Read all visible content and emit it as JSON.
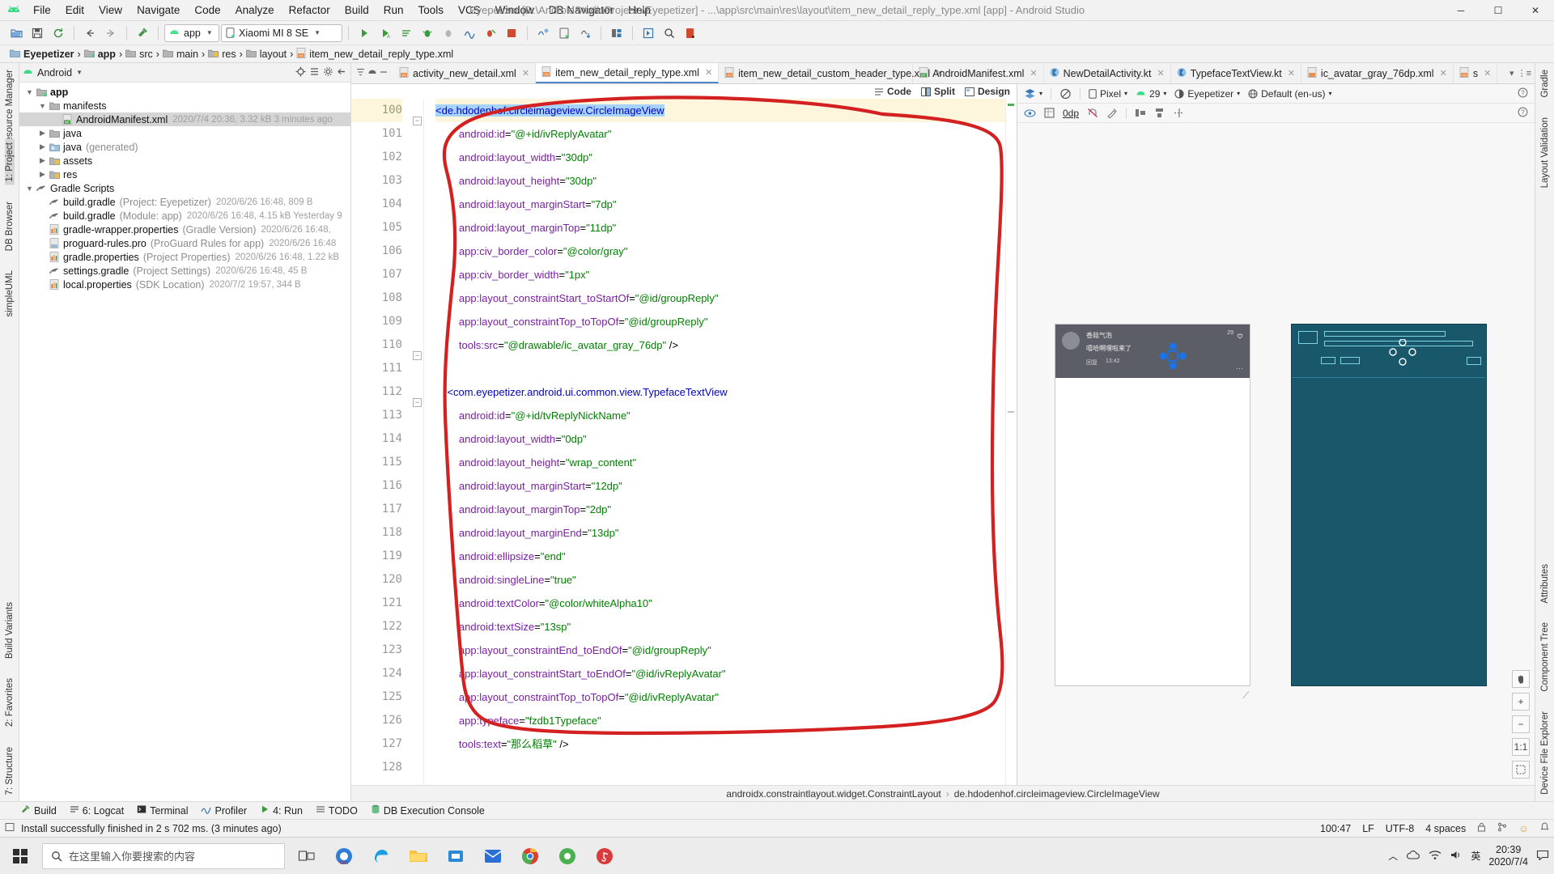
{
  "titlebar": {
    "menus": [
      "File",
      "Edit",
      "View",
      "Navigate",
      "Code",
      "Analyze",
      "Refactor",
      "Build",
      "Run",
      "Tools",
      "VCS",
      "Window",
      "DB Navigator",
      "Help"
    ],
    "window_title": "Eyepetizer [D:\\AndroidStudioProjects\\Eyepetizer] - ...\\app\\src\\main\\res\\layout\\item_new_detail_reply_type.xml [app] - Android Studio",
    "minimize": "─",
    "maximize": "☐",
    "close": "✕"
  },
  "toolbar": {
    "module_selector": "app",
    "device_selector": "Xiaomi MI 8 SE"
  },
  "breadcrumb": {
    "items": [
      {
        "label": "Eyepetizer",
        "bold": true,
        "icon": "project-icon"
      },
      {
        "label": "app",
        "bold": true,
        "icon": "module-icon"
      },
      {
        "label": "src",
        "bold": false,
        "icon": "folder-icon"
      },
      {
        "label": "main",
        "bold": false,
        "icon": "folder-icon"
      },
      {
        "label": "res",
        "bold": false,
        "icon": "res-folder-icon"
      },
      {
        "label": "layout",
        "bold": false,
        "icon": "folder-icon"
      },
      {
        "label": "item_new_detail_reply_type.xml",
        "bold": false,
        "icon": "xml-file-icon"
      }
    ]
  },
  "left_rail": {
    "top": [
      "Resource Manager"
    ],
    "middle": [
      "1: Project",
      "DB Browser",
      "simpleUML"
    ],
    "bottom": [
      "Build Variants",
      "2: Favorites",
      "7: Structure"
    ]
  },
  "right_rail": {
    "items": [
      "Gradle",
      "Layout Validation",
      "Attributes",
      "Component Tree",
      "Device File Explorer"
    ]
  },
  "project_panel": {
    "title": "Android",
    "tree": [
      {
        "indent": 0,
        "arrow": "open",
        "icon": "module-icon",
        "label": "app",
        "bold": true,
        "meta": "",
        "sub": ""
      },
      {
        "indent": 1,
        "arrow": "open",
        "icon": "folder-icon",
        "label": "manifests",
        "bold": false,
        "meta": "",
        "sub": ""
      },
      {
        "indent": 2,
        "arrow": "none",
        "icon": "manifest-icon",
        "label": "AndroidManifest.xml",
        "bold": false,
        "meta": "2020/7/4 20:36, 3.32 kB  3 minutes ago",
        "sub": "",
        "selected": true
      },
      {
        "indent": 1,
        "arrow": "closed",
        "icon": "folder-icon",
        "label": "java",
        "bold": false,
        "meta": "",
        "sub": ""
      },
      {
        "indent": 1,
        "arrow": "closed",
        "icon": "folder-gen-icon",
        "label": "java",
        "bold": false,
        "meta": "",
        "sub": "(generated)"
      },
      {
        "indent": 1,
        "arrow": "closed",
        "icon": "res-folder-icon",
        "label": "assets",
        "bold": false,
        "meta": "",
        "sub": ""
      },
      {
        "indent": 1,
        "arrow": "closed",
        "icon": "res-folder-icon",
        "label": "res",
        "bold": false,
        "meta": "",
        "sub": ""
      },
      {
        "indent": 0,
        "arrow": "open",
        "icon": "gradle-icon",
        "label": "Gradle Scripts",
        "bold": false,
        "meta": "",
        "sub": ""
      },
      {
        "indent": 1,
        "arrow": "none",
        "icon": "gradle-icon",
        "label": "build.gradle",
        "bold": false,
        "meta": "2020/6/26 16:48, 809 B",
        "sub": "(Project: Eyepetizer)"
      },
      {
        "indent": 1,
        "arrow": "none",
        "icon": "gradle-icon",
        "label": "build.gradle",
        "bold": false,
        "meta": "2020/6/26 16:48, 4.15 kB  Yesterday 9",
        "sub": "(Module: app)"
      },
      {
        "indent": 1,
        "arrow": "none",
        "icon": "properties-icon",
        "label": "gradle-wrapper.properties",
        "bold": false,
        "meta": "2020/6/26 16:48,",
        "sub": "(Gradle Version)"
      },
      {
        "indent": 1,
        "arrow": "none",
        "icon": "file-icon",
        "label": "proguard-rules.pro",
        "bold": false,
        "meta": "2020/6/26 16:48",
        "sub": "(ProGuard Rules for app)"
      },
      {
        "indent": 1,
        "arrow": "none",
        "icon": "properties-icon",
        "label": "gradle.properties",
        "bold": false,
        "meta": "2020/6/26 16:48, 1.22 kB",
        "sub": "(Project Properties)"
      },
      {
        "indent": 1,
        "arrow": "none",
        "icon": "gradle-icon",
        "label": "settings.gradle",
        "bold": false,
        "meta": "2020/6/26 16:48, 45 B",
        "sub": "(Project Settings)"
      },
      {
        "indent": 1,
        "arrow": "none",
        "icon": "properties-icon",
        "label": "local.properties",
        "bold": false,
        "meta": "2020/7/2 19:57, 344 B",
        "sub": "(SDK Location)"
      }
    ]
  },
  "editor_tabs": [
    {
      "label": "activity_new_detail.xml",
      "icon": "xml-file-icon",
      "active": false
    },
    {
      "label": "item_new_detail_reply_type.xml",
      "icon": "xml-file-icon",
      "active": true
    },
    {
      "label": "item_new_detail_custom_header_type.xml",
      "icon": "xml-file-icon",
      "active": false
    },
    {
      "label": "AndroidManifest.xml",
      "icon": "manifest-icon",
      "active": false
    },
    {
      "label": "NewDetailActivity.kt",
      "icon": "kotlin-file-icon",
      "active": false
    },
    {
      "label": "TypefaceTextView.kt",
      "icon": "kotlin-file-icon",
      "active": false
    },
    {
      "label": "ic_avatar_gray_76dp.xml",
      "icon": "drawable-file-icon",
      "active": false
    },
    {
      "label": "s",
      "icon": "xml-file-icon",
      "active": false
    }
  ],
  "editor_modes": {
    "code": "Code",
    "split": "Split",
    "design": "Design",
    "selected": "Split"
  },
  "code": {
    "first_line_number": 100,
    "lines": [
      {
        "n": 100,
        "indent": 0,
        "highlight": true,
        "tokens": [
          {
            "t": "<de.hdodenhof.circleimageview.CircleImageView",
            "c": "tag",
            "sel": true
          }
        ]
      },
      {
        "n": 101,
        "indent": 2,
        "tokens": [
          {
            "t": "android:id",
            "c": "attr"
          },
          {
            "t": "=",
            "c": "punc"
          },
          {
            "t": "\"@+id/ivReplyAvatar\"",
            "c": "val"
          }
        ]
      },
      {
        "n": 102,
        "indent": 2,
        "tokens": [
          {
            "t": "android:layout_width",
            "c": "attr"
          },
          {
            "t": "=",
            "c": "punc"
          },
          {
            "t": "\"30dp\"",
            "c": "val"
          }
        ]
      },
      {
        "n": 103,
        "indent": 2,
        "tokens": [
          {
            "t": "android:layout_height",
            "c": "attr"
          },
          {
            "t": "=",
            "c": "punc"
          },
          {
            "t": "\"30dp\"",
            "c": "val"
          }
        ]
      },
      {
        "n": 104,
        "indent": 2,
        "tokens": [
          {
            "t": "android:layout_marginStart",
            "c": "attr"
          },
          {
            "t": "=",
            "c": "punc"
          },
          {
            "t": "\"7dp\"",
            "c": "val"
          }
        ]
      },
      {
        "n": 105,
        "indent": 2,
        "tokens": [
          {
            "t": "android:layout_marginTop",
            "c": "attr"
          },
          {
            "t": "=",
            "c": "punc"
          },
          {
            "t": "\"11dp\"",
            "c": "val"
          }
        ]
      },
      {
        "n": 106,
        "indent": 2,
        "tokens": [
          {
            "t": "app:civ_border_color",
            "c": "attr"
          },
          {
            "t": "=",
            "c": "punc"
          },
          {
            "t": "\"@color/gray\"",
            "c": "val"
          }
        ]
      },
      {
        "n": 107,
        "indent": 2,
        "tokens": [
          {
            "t": "app:civ_border_width",
            "c": "attr"
          },
          {
            "t": "=",
            "c": "punc"
          },
          {
            "t": "\"1px\"",
            "c": "val"
          }
        ]
      },
      {
        "n": 108,
        "indent": 2,
        "tokens": [
          {
            "t": "app:layout_constraintStart_toStartOf",
            "c": "attr"
          },
          {
            "t": "=",
            "c": "punc"
          },
          {
            "t": "\"@id/groupReply\"",
            "c": "val"
          }
        ]
      },
      {
        "n": 109,
        "indent": 2,
        "tokens": [
          {
            "t": "app:layout_constraintTop_toTopOf",
            "c": "attr"
          },
          {
            "t": "=",
            "c": "punc"
          },
          {
            "t": "\"@id/groupReply\"",
            "c": "val"
          }
        ]
      },
      {
        "n": 110,
        "indent": 2,
        "tokens": [
          {
            "t": "tools:src",
            "c": "attr"
          },
          {
            "t": "=",
            "c": "punc"
          },
          {
            "t": "\"@drawable/ic_avatar_gray_76dp\"",
            "c": "val"
          },
          {
            "t": " />",
            "c": "punc"
          }
        ]
      },
      {
        "n": 111,
        "indent": 0,
        "tokens": []
      },
      {
        "n": 112,
        "indent": 1,
        "tokens": [
          {
            "t": "<com.eyepetizer.android.ui.common.view.TypefaceTextView",
            "c": "tag"
          }
        ]
      },
      {
        "n": 113,
        "indent": 2,
        "tokens": [
          {
            "t": "android:id",
            "c": "attr"
          },
          {
            "t": "=",
            "c": "punc"
          },
          {
            "t": "\"@+id/tvReplyNickName\"",
            "c": "val"
          }
        ]
      },
      {
        "n": 114,
        "indent": 2,
        "tokens": [
          {
            "t": "android:layout_width",
            "c": "attr"
          },
          {
            "t": "=",
            "c": "punc"
          },
          {
            "t": "\"0dp\"",
            "c": "val"
          }
        ]
      },
      {
        "n": 115,
        "indent": 2,
        "tokens": [
          {
            "t": "android:layout_height",
            "c": "attr"
          },
          {
            "t": "=",
            "c": "punc"
          },
          {
            "t": "\"wrap_content\"",
            "c": "val"
          }
        ]
      },
      {
        "n": 116,
        "indent": 2,
        "tokens": [
          {
            "t": "android:layout_marginStart",
            "c": "attr"
          },
          {
            "t": "=",
            "c": "punc"
          },
          {
            "t": "\"12dp\"",
            "c": "val"
          }
        ]
      },
      {
        "n": 117,
        "indent": 2,
        "tokens": [
          {
            "t": "android:layout_marginTop",
            "c": "attr"
          },
          {
            "t": "=",
            "c": "punc"
          },
          {
            "t": "\"2dp\"",
            "c": "val"
          }
        ]
      },
      {
        "n": 118,
        "indent": 2,
        "tokens": [
          {
            "t": "android:layout_marginEnd",
            "c": "attr"
          },
          {
            "t": "=",
            "c": "punc"
          },
          {
            "t": "\"13dp\"",
            "c": "val"
          }
        ]
      },
      {
        "n": 119,
        "indent": 2,
        "tokens": [
          {
            "t": "android:ellipsize",
            "c": "attr"
          },
          {
            "t": "=",
            "c": "punc"
          },
          {
            "t": "\"end\"",
            "c": "val"
          }
        ]
      },
      {
        "n": 120,
        "indent": 2,
        "tokens": [
          {
            "t": "android:singleLine",
            "c": "attr"
          },
          {
            "t": "=",
            "c": "punc"
          },
          {
            "t": "\"true\"",
            "c": "val"
          }
        ]
      },
      {
        "n": 121,
        "indent": 2,
        "tokens": [
          {
            "t": "android:textColor",
            "c": "attr"
          },
          {
            "t": "=",
            "c": "punc"
          },
          {
            "t": "\"@color/whiteAlpha10\"",
            "c": "val"
          }
        ]
      },
      {
        "n": 122,
        "indent": 2,
        "tokens": [
          {
            "t": "android:textSize",
            "c": "attr"
          },
          {
            "t": "=",
            "c": "punc"
          },
          {
            "t": "\"13sp\"",
            "c": "val"
          }
        ]
      },
      {
        "n": 123,
        "indent": 2,
        "tokens": [
          {
            "t": "app:layout_constraintEnd_toEndOf",
            "c": "attr"
          },
          {
            "t": "=",
            "c": "punc"
          },
          {
            "t": "\"@id/groupReply\"",
            "c": "val"
          }
        ]
      },
      {
        "n": 124,
        "indent": 2,
        "tokens": [
          {
            "t": "app:layout_constraintStart_toEndOf",
            "c": "attr"
          },
          {
            "t": "=",
            "c": "punc"
          },
          {
            "t": "\"@id/ivReplyAvatar\"",
            "c": "val"
          }
        ]
      },
      {
        "n": 125,
        "indent": 2,
        "tokens": [
          {
            "t": "app:layout_constraintTop_toTopOf",
            "c": "attr"
          },
          {
            "t": "=",
            "c": "punc"
          },
          {
            "t": "\"@id/ivReplyAvatar\"",
            "c": "val"
          }
        ]
      },
      {
        "n": 126,
        "indent": 2,
        "tokens": [
          {
            "t": "app:typeface",
            "c": "attr"
          },
          {
            "t": "=",
            "c": "punc"
          },
          {
            "t": "\"fzdb1Typeface\"",
            "c": "val"
          }
        ]
      },
      {
        "n": 127,
        "indent": 2,
        "tokens": [
          {
            "t": "tools:text",
            "c": "attr"
          },
          {
            "t": "=",
            "c": "punc"
          },
          {
            "t": "\"那么稻草\"",
            "c": "val"
          },
          {
            "t": " />",
            "c": "punc"
          }
        ]
      },
      {
        "n": 128,
        "indent": 0,
        "tokens": []
      }
    ]
  },
  "preview_toolbar": {
    "row1": [
      {
        "icon": "layers-icon",
        "label": ""
      },
      {
        "icon": "no-orientation-icon",
        "label": ""
      },
      {
        "icon": "device-icon",
        "label": "Pixel"
      },
      {
        "icon": "android-icon",
        "label": "29"
      },
      {
        "icon": "theme-icon",
        "label": "Eyepetizer"
      },
      {
        "icon": "locale-icon",
        "label": "Default (en-us)"
      }
    ],
    "row2": [
      {
        "icon": "eye-icon",
        "label": ""
      },
      {
        "icon": "blueprint-icon",
        "label": ""
      },
      {
        "icon": "margin-icon",
        "label": "0dp"
      },
      {
        "icon": "magnet-off-icon",
        "label": ""
      },
      {
        "icon": "wand-icon",
        "label": ""
      },
      {
        "icon": "align-h-icon",
        "label": ""
      },
      {
        "icon": "align-v-icon",
        "label": ""
      },
      {
        "icon": "guideline-icon",
        "label": ""
      }
    ],
    "help_icon": "help-icon",
    "zoom_fit_label": "1:1"
  },
  "preview_device": {
    "card_title": "香菇气泡",
    "card_text": "嘻哈啊嘿啦来了",
    "card_reply": "回复",
    "card_time": "13:42",
    "card_count": "29"
  },
  "bottom_breadcrumb": {
    "items": [
      "androidx.constraintlayout.widget.ConstraintLayout",
      "de.hdodenhof.circleimageview.CircleImageView"
    ]
  },
  "toolwindow_bar": {
    "items": [
      {
        "label": "Build",
        "icon": "build-icon"
      },
      {
        "label": "6: Logcat",
        "icon": "logcat-icon"
      },
      {
        "label": "Terminal",
        "icon": "terminal-icon"
      },
      {
        "label": "Profiler",
        "icon": "profiler-icon"
      },
      {
        "label": "4: Run",
        "icon": "run-icon"
      },
      {
        "label": "TODO",
        "icon": "todo-icon"
      },
      {
        "label": "DB Execution Console",
        "icon": "db-icon"
      }
    ]
  },
  "statusbar": {
    "message": "Install successfully finished in 2 s 702 ms. (3 minutes ago)",
    "caret": "100:47",
    "line_sep": "LF",
    "encoding": "UTF-8",
    "indent": "4 spaces",
    "lock_icon": "lock-icon",
    "branch_icon": "branch-icon",
    "smiley_icon": "smiley-icon"
  },
  "taskbar": {
    "search_placeholder": "在这里输入你要搜索的内容",
    "clock_time": "20:39",
    "clock_date": "2020/7/4",
    "ime_label": "英",
    "icons": [
      "start-icon",
      "search-icon",
      "task-view-icon",
      "browser-icon",
      "edge-icon",
      "file-explorer-icon",
      "store-icon",
      "mail-icon",
      "chrome-icon",
      "app-icon",
      "music-icon"
    ]
  },
  "colors": {
    "accent_blue": "#4e86c7",
    "annotation_red": "#d32020",
    "tag_blue": "#0000c0",
    "attr_purple": "#7a1fa2",
    "value_green": "#008000",
    "selection_blue": "#a6d2ff",
    "highlight_yellow": "#fdf6dd"
  }
}
